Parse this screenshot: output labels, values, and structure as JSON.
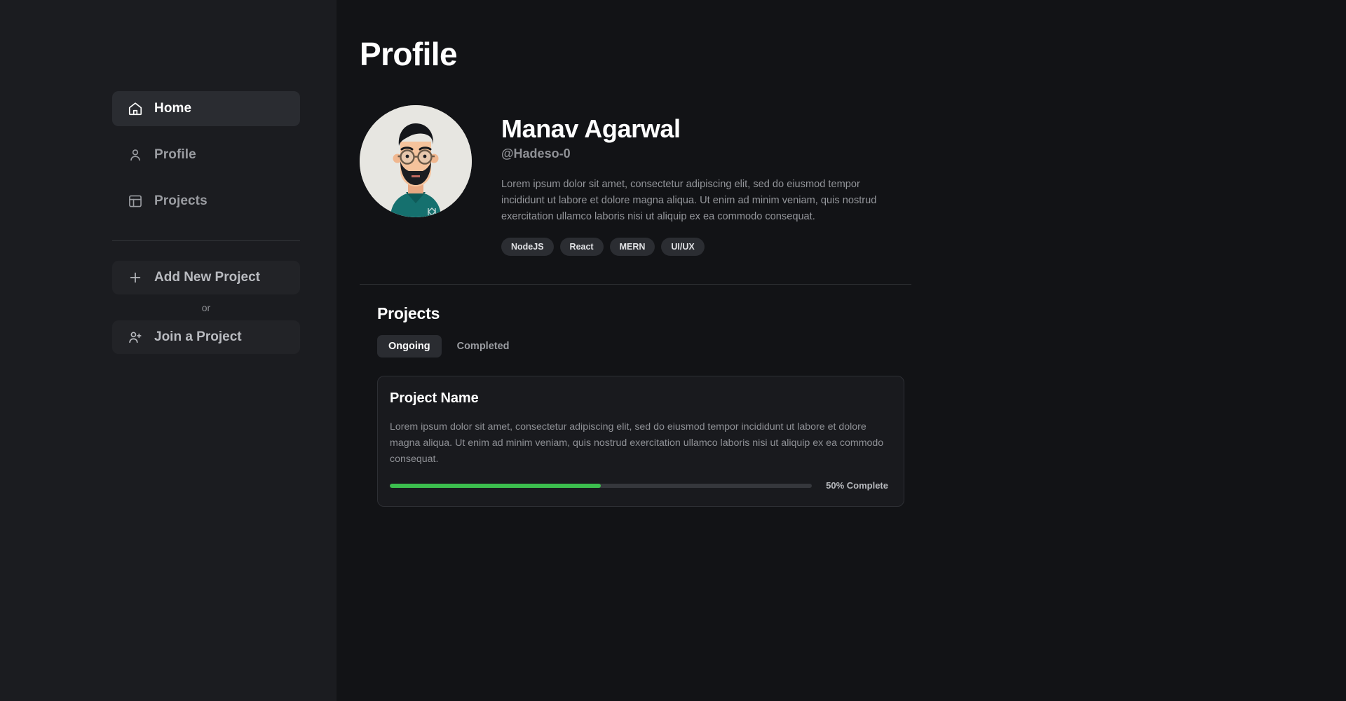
{
  "sidebar": {
    "nav_items": [
      {
        "label": "Home",
        "icon": "home-icon",
        "active": true
      },
      {
        "label": "Profile",
        "icon": "user-icon",
        "active": false
      },
      {
        "label": "Projects",
        "icon": "layout-icon",
        "active": false
      }
    ],
    "add_project_label": "Add New Project",
    "add_project_icon": "plus-icon",
    "or_label": "or",
    "join_project_label": "Join a Project",
    "join_project_icon": "user-plus-icon"
  },
  "main": {
    "page_title": "Profile",
    "profile": {
      "avatar_icon": "user-avatar-illustration",
      "name": "Manav Agarwal",
      "handle": "@Hadeso-0",
      "bio": "Lorem ipsum dolor sit amet, consectetur adipiscing elit, sed do eiusmod tempor incididunt ut labore et dolore magna aliqua. Ut enim ad minim veniam, quis nostrud exercitation ullamco laboris nisi ut aliquip ex ea commodo consequat.",
      "tags": [
        "NodeJS",
        "React",
        "MERN",
        "UI/UX"
      ]
    },
    "projects": {
      "section_title": "Projects",
      "tabs": [
        {
          "label": "Ongoing",
          "active": true
        },
        {
          "label": "Completed",
          "active": false
        }
      ],
      "cards": [
        {
          "name": "Project Name",
          "description": "Lorem ipsum dolor sit amet, consectetur adipiscing elit, sed do eiusmod tempor incididunt ut labore et dolore magna aliqua. Ut enim ad minim veniam, quis nostrud exercitation ullamco laboris nisi ut aliquip ex ea commodo consequat.",
          "progress_percent": 50,
          "progress_label": "50% Complete"
        }
      ]
    }
  },
  "colors": {
    "sidebar_bg": "#1b1c20",
    "main_bg": "#121316",
    "active_item_bg": "#2a2c31",
    "progress_green": "#3cbe4e",
    "muted_text": "#94969b"
  }
}
